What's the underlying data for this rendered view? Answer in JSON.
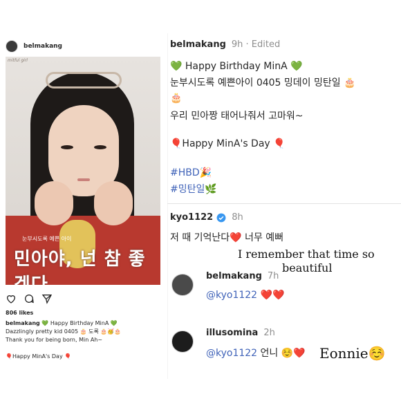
{
  "post": {
    "username": "belmakang",
    "photo_label": "mitful girl",
    "photo_text_small": "눈부시도록 예쁜 아이",
    "photo_text_big": "민아야, 넌 참 좋겠다",
    "likes": "806 likes",
    "caption_user": "belmakang",
    "caption_line1": "💚 Happy Birthday MinA 💚",
    "caption_line2": "Dazzlingly pretty kid 0405 🎂 도록 🎂🥳🎂",
    "caption_line3": "Thank you for being born, Min Ah~",
    "caption_line4": "🎈Happy MinA's Day 🎈"
  },
  "thread": {
    "username": "belmakang",
    "meta": "9h · Edited",
    "line1": "💚 Happy Birthday MinA 💚",
    "line2": "눈부시도록 예쁜아이  0405 밍데이 밍탄일 🎂",
    "line3": "🎂",
    "line4": "우리 민아짱 태어나줘서 고마워~",
    "line5": "🎈Happy MinA's Day 🎈",
    "hashtag1": "#HBD🎉",
    "hashtag2": "#밍탄일🌿"
  },
  "comment1": {
    "username": "kyo1122",
    "time": "8h",
    "text": "저 때 기억난다❤️ 너무 예뻐",
    "translation_line1": "I remember that time so",
    "translation_line2": "beautiful"
  },
  "reply1": {
    "username": "belmakang",
    "time": "7h",
    "mention": "@kyo1122",
    "text": "❤️❤️"
  },
  "reply2": {
    "username": "illusomina",
    "time": "2h",
    "mention": "@kyo1122",
    "text": "언니 ☺️❤️",
    "translation": "Eonnie☺️"
  },
  "colors": {
    "link": "#3f62b8",
    "verified": "#3897f0",
    "meta": "#8e8e8e"
  }
}
